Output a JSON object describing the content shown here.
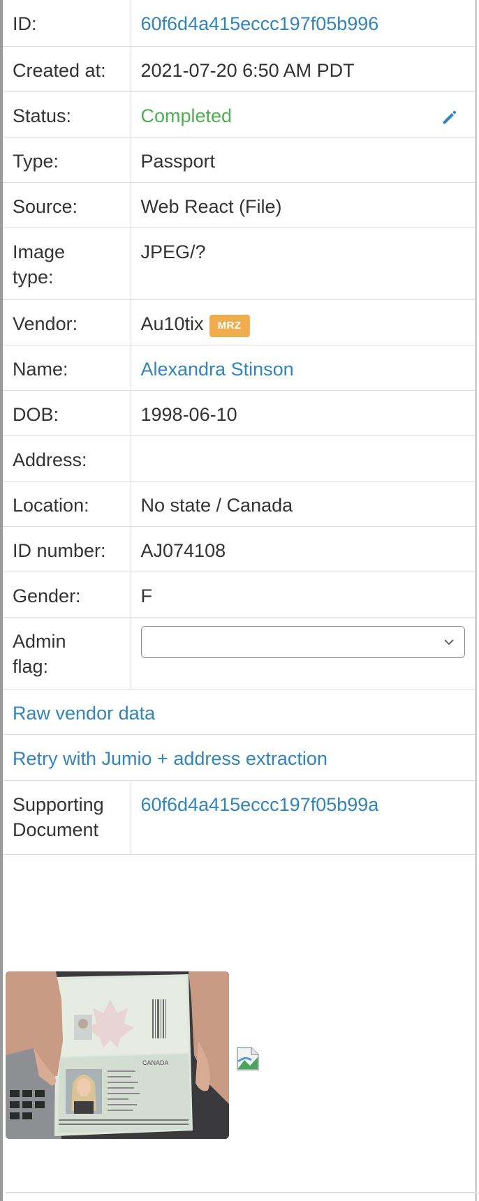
{
  "rows": {
    "id": {
      "label": "ID:",
      "value": "60f6d4a415eccc197f05b996"
    },
    "created": {
      "label": "Created at:",
      "value": "2021-07-20 6:50 AM PDT"
    },
    "status": {
      "label": "Status:",
      "value": "Completed"
    },
    "type": {
      "label": "Type:",
      "value": "Passport"
    },
    "source": {
      "label": "Source:",
      "value": "Web React (File)"
    },
    "image_type": {
      "label_line1": "Image",
      "label_line2": "type:",
      "value": "JPEG/?"
    },
    "vendor": {
      "label": "Vendor:",
      "value": "Au10tix",
      "badge": "MRZ"
    },
    "name": {
      "label": "Name:",
      "value": "Alexandra Stinson"
    },
    "dob": {
      "label": "DOB:",
      "value": "1998-06-10"
    },
    "address": {
      "label": "Address:",
      "value": ""
    },
    "location": {
      "label": "Location:",
      "value": "No state / Canada"
    },
    "id_number": {
      "label": "ID number:",
      "value": "AJ074108"
    },
    "gender": {
      "label": "Gender:",
      "value": "F"
    },
    "admin_flag": {
      "label_line1": "Admin",
      "label_line2": "flag:",
      "selected": ""
    },
    "raw_vendor": {
      "text": "Raw vendor data"
    },
    "retry": {
      "text": "Retry with Jumio + address extraction"
    },
    "supporting": {
      "label_line1": "Supporting",
      "label_line2": "Document",
      "value": "60f6d4a415eccc197f05b99a"
    }
  },
  "passport_image": {
    "country_text": "CANADA"
  },
  "colors": {
    "link": "#3184bd",
    "success": "#4cb050",
    "badge": "#f0ad4e"
  },
  "icons": {
    "edit": "pencil-icon",
    "dropdown": "chevron-down-icon",
    "broken_image": "broken-image-icon"
  }
}
